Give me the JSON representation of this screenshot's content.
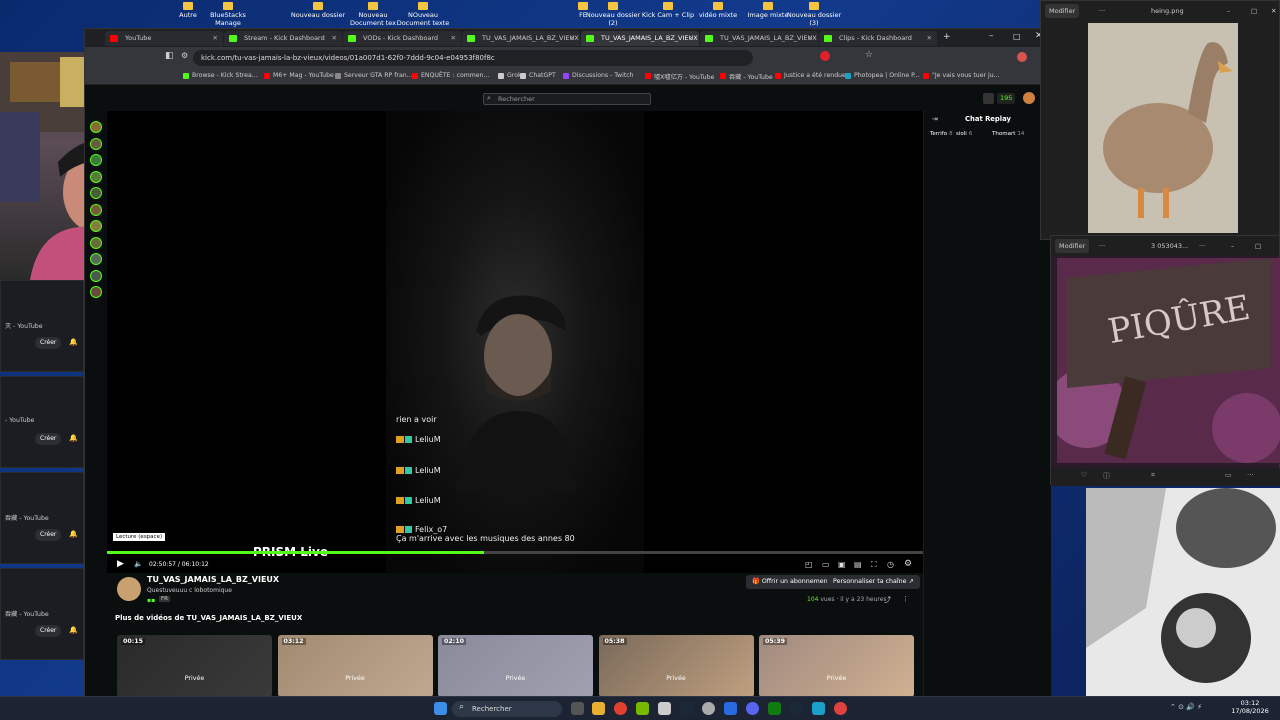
{
  "desktop_icons": [
    "Autre",
    "BlueStacks Manage",
    "Nouveau dossier",
    "Nouveau Document tex",
    "NOuveau Document texte",
    "FE",
    "Nouveau dossier (2)",
    "Kick Cam + Clip",
    "vidéo mixte",
    "Image mixte",
    "Nouveau dossier (3)"
  ],
  "tabs": [
    {
      "label": "YouTube",
      "color": "#ff0000"
    },
    {
      "label": "Stream - Kick Dashboard",
      "color": "#53fc18"
    },
    {
      "label": "VODs - Kick Dashboard",
      "color": "#53fc18"
    },
    {
      "label": "TU_VAS_JAMAIS_LA_BZ_VIEUX",
      "color": "#53fc18"
    },
    {
      "label": "TU_VAS_JAMAIS_LA_BZ_VIEUX",
      "color": "#53fc18"
    },
    {
      "label": "TU_VAS_JAMAIS_LA_BZ_VIEUX",
      "color": "#53fc18"
    },
    {
      "label": "Clips - Kick Dashboard",
      "color": "#53fc18"
    }
  ],
  "url": "kick.com/tu-vas-jamais-la-bz-vieux/videos/01a007d1-62f0-7ddd-9c04-e04953f80f8c",
  "bookmarks": [
    {
      "label": "Browse - Kick Strea...",
      "color": "#53fc18"
    },
    {
      "label": "M6+ Mag - YouTube",
      "color": "#ff0000"
    },
    {
      "label": "Serveur GTA RP fran...",
      "color": "#888888"
    },
    {
      "label": "ENQUÊTE : commen...",
      "color": "#ff0000"
    },
    {
      "label": "Grok",
      "color": "#cccccc"
    },
    {
      "label": "ChatGPT",
      "color": "#cccccc"
    },
    {
      "label": "Discussions - Twitch",
      "color": "#9146ff"
    },
    {
      "label": "嘘X嘘亿万 - YouTube",
      "color": "#ff0000"
    },
    {
      "label": "吞藏 - YouTube",
      "color": "#ff0000"
    },
    {
      "label": "Justice a été rendue...",
      "color": "#ff0000"
    },
    {
      "label": "Photopea | Online P...",
      "color": "#1ba0c9"
    },
    {
      "label": "\"Je vais vous tuer ju...",
      "color": "#ff0000"
    }
  ],
  "kick": {
    "search_placeholder": "Rechercher",
    "coins": "195",
    "chat_title": "Chat Replay",
    "chat_users": [
      {
        "name": "Terrifo",
        "n": "8"
      },
      {
        "name": "sioli",
        "n": "6"
      },
      {
        "name": "Thomart",
        "n": "14"
      }
    ]
  },
  "overlay_chat": [
    {
      "text": "rien a voir",
      "user": ""
    },
    {
      "text": "",
      "user": "LeliuM"
    },
    {
      "text": "",
      "user": "LeliuM"
    },
    {
      "text": "",
      "user": "LeliuM"
    },
    {
      "text": "Ça m'arrive avec les musiques des annes 80",
      "user": "Felix_o7"
    }
  ],
  "prism": "PRISM Live",
  "player": {
    "tooltip": "Lecture (espace)",
    "time": "02:50:57 / 06:10:12",
    "progress_fraction": 0.462
  },
  "channel": {
    "name": "TU_VAS_JAMAIS_LA_BZ_VIEUX",
    "subtitle": "Questuveuuu c lobotomique",
    "tag": "FR",
    "subscribe": "Offrir un abonnement",
    "customize": "Personnaliser ta chaîne",
    "views": "104",
    "views_label": "vues",
    "age": "il y a 23 heures"
  },
  "more_videos": {
    "title": "Plus de vidéos de TU_VAS_JAMAIS_LA_BZ_VIEUX",
    "items": [
      {
        "duration": "00:15",
        "label": "Privée"
      },
      {
        "duration": "03:12",
        "label": "Privée"
      },
      {
        "duration": "02:10",
        "label": "Privée"
      },
      {
        "duration": "05:38",
        "label": "Privée"
      },
      {
        "duration": "05:39",
        "label": "Privée"
      }
    ]
  },
  "left_panels": [
    {
      "label": "灭 - YouTube",
      "button": "Créer"
    },
    {
      "label": "- YouTube",
      "button": "Créer"
    },
    {
      "label": "吞藏 - YouTube",
      "button": "Créer"
    },
    {
      "label": "吞藏 - YouTube",
      "button": "Créer"
    }
  ],
  "image_windows": [
    {
      "title": "heing.png",
      "edit": "Modifier"
    },
    {
      "title": "3 053043...",
      "edit": "Modifier",
      "sign": "PIQÛRE"
    }
  ],
  "taskbar": {
    "search": "Rechercher",
    "time": "03:12",
    "date": "17/08/2026"
  }
}
